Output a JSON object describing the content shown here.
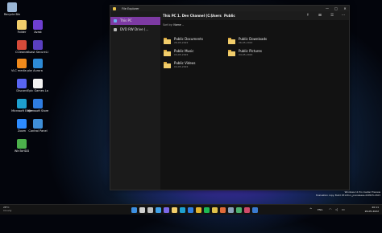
{
  "window": {
    "title": "File Explorer",
    "controls": {
      "minimize": "—",
      "maximize": "□",
      "close": "✕"
    }
  },
  "sidebar": {
    "items": [
      {
        "label": "This PC",
        "icon": "monitor-icon",
        "active": true
      },
      {
        "label": "DVD RW Drive (...",
        "icon": "disc-drive-icon",
        "active": false
      }
    ]
  },
  "breadcrumb": [
    "This PC",
    "1. Dev Channel (C:)",
    "Users",
    "Public"
  ],
  "breadcrumb_separator": "›",
  "toolbar": {
    "up_icon": "↑",
    "new_folder_icon": "⊞",
    "view_icon": "☰",
    "more_icon": "⋯"
  },
  "sort": {
    "label": "Sort by:",
    "value": "Name",
    "chevron": "⌄"
  },
  "folders": [
    {
      "name": "Public Documents",
      "date": "26-05-2022"
    },
    {
      "name": "Public Downloads",
      "date": "26-05-2022"
    },
    {
      "name": "Public Music",
      "date": "04-05-2022"
    },
    {
      "name": "Public Pictures",
      "date": "04-05-2022"
    },
    {
      "name": "Public Videos",
      "date": "04-05-2022"
    }
  ],
  "desktop_icons": [
    {
      "label": "Recycle Bin",
      "icon": "recycle-bin-icon",
      "color": "#9ab6d6"
    },
    {
      "label": "Folder",
      "icon": "folder-icon",
      "color": "#f1cd6b"
    },
    {
      "label": "Avast",
      "icon": "app-icon",
      "color": "#6e3fd0"
    },
    {
      "label": "CCleaner",
      "icon": "ccleaner-icon",
      "color": "#d54a3a"
    },
    {
      "label": "Avast SecureLine",
      "icon": "shield-icon",
      "color": "#5a3fc0"
    },
    {
      "label": "VLC media player",
      "icon": "vlc-icon",
      "color": "#f08a1c"
    },
    {
      "label": "Aurora",
      "icon": "app-icon",
      "color": "#2d8ad6"
    },
    {
      "label": "Discord",
      "icon": "discord-icon",
      "color": "#5865f2"
    },
    {
      "label": "Epic Games Launcher",
      "icon": "epic-icon",
      "color": "#f2f2f2"
    },
    {
      "label": "Microsoft Edge",
      "icon": "edge-icon",
      "color": "#1ea0d0"
    },
    {
      "label": "Microsoft Store",
      "icon": "store-icon",
      "color": "#2f7de1"
    },
    {
      "label": "Zoom",
      "icon": "zoom-icon",
      "color": "#2d8cff"
    },
    {
      "label": "Control Panel",
      "icon": "control-panel-icon",
      "color": "#3f8fd8"
    },
    {
      "label": "WinToHDD",
      "icon": "app-icon",
      "color": "#4cb04c"
    }
  ],
  "watermark": {
    "line1": "Windows 11 Pro Insider Preview",
    "line2": "Evaluation copy. Build 25120.rs_prerelease.220525-1503",
    "line3": ""
  },
  "taskbar": {
    "weather_temp": "28°C",
    "weather_desc": "Cloudy",
    "icons": [
      {
        "name": "start",
        "color": "#3d8fe0"
      },
      {
        "name": "search",
        "color": "#cfcfcf"
      },
      {
        "name": "task-view",
        "color": "#bfbfbf"
      },
      {
        "name": "widgets",
        "color": "#3fa0e8"
      },
      {
        "name": "chat",
        "color": "#7b67e8"
      },
      {
        "name": "file-explorer",
        "color": "#f1cd6b"
      },
      {
        "name": "edge",
        "color": "#1ea0d0"
      },
      {
        "name": "store",
        "color": "#2f7de1"
      },
      {
        "name": "chrome",
        "color": "#e4b32e"
      },
      {
        "name": "spotify",
        "color": "#1db954"
      },
      {
        "name": "app",
        "color": "#e0c14a"
      },
      {
        "name": "app",
        "color": "#e06a3a"
      },
      {
        "name": "app",
        "color": "#8aa0b8"
      },
      {
        "name": "app",
        "color": "#4caf70"
      },
      {
        "name": "app",
        "color": "#d04a6a"
      },
      {
        "name": "app",
        "color": "#3a7ad0"
      }
    ],
    "tray_chevron": "^",
    "tray_lang": "ENG",
    "clock_time": "20:11",
    "clock_date": "26-05-2022"
  }
}
